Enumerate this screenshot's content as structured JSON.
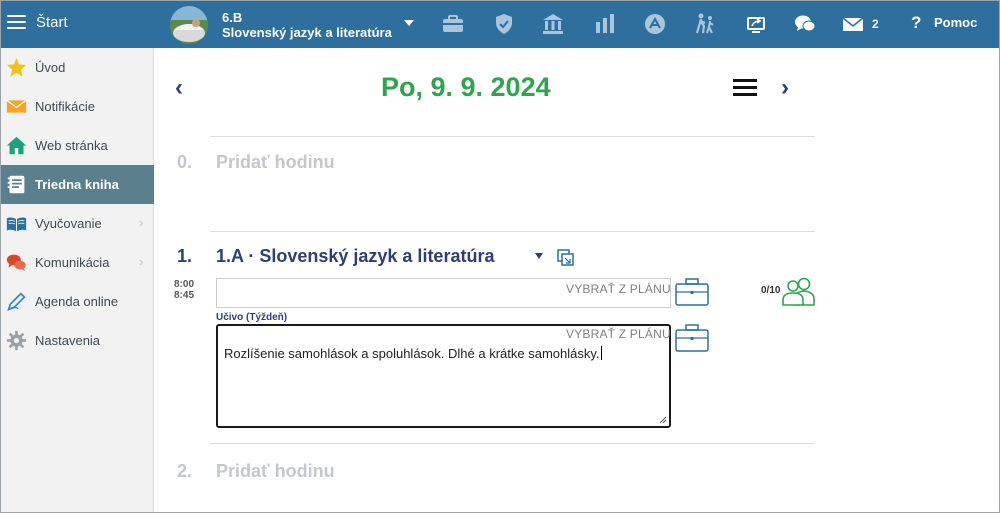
{
  "header": {
    "start_label": "Štart",
    "class_name": "6.B",
    "subject": "Slovenský jazyk a literatúra",
    "mail_count": "2",
    "help_label": "Pomoc",
    "accent_color": "#2e6f9e"
  },
  "sidebar": {
    "items": [
      {
        "label": "Úvod",
        "icon": "star-icon"
      },
      {
        "label": "Notifikácie",
        "icon": "envelope-icon"
      },
      {
        "label": "Web stránka",
        "icon": "home-icon"
      },
      {
        "label": "Triedna kniha",
        "icon": "class-book-icon",
        "active": true
      },
      {
        "label": "Vyučovanie",
        "icon": "open-book-icon"
      },
      {
        "label": "Komunikácia",
        "icon": "chat-bubbles-icon"
      },
      {
        "label": "Agenda online",
        "icon": "pen-icon"
      },
      {
        "label": "Nastavenia",
        "icon": "gear-icon"
      }
    ],
    "chevron": "›"
  },
  "main": {
    "prev": "‹",
    "next": "›",
    "date": "Po, 9. 9. 2024",
    "hour0": {
      "number": "0.",
      "label": "Pridať hodinu"
    },
    "hour1": {
      "number": "1.",
      "title": "1.A · Slovenský jazyk a literatúra",
      "time_start": "8:00",
      "time_end": "8:45",
      "select_plan": "VYBRAŤ Z PLÁNU",
      "attendance": "0/10",
      "curriculum_label": "Učivo (Týždeň)",
      "curriculum_text": "Rozlíšenie samohlások a spoluhlások. Dlhé a krátke samohlásky."
    },
    "hour2": {
      "number": "2.",
      "label": "Pridať hodinu"
    }
  }
}
